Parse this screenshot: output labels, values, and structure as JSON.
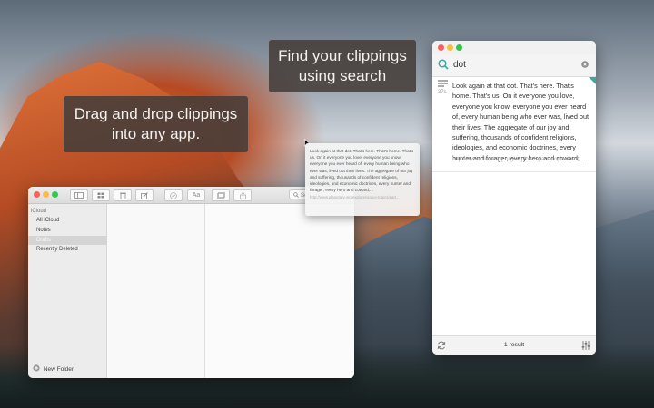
{
  "callouts": {
    "drag": "Drag and drop clippings\ninto any app.",
    "search": "Find your clippings\nusing search"
  },
  "notes_window": {
    "search_placeholder": "Search",
    "format_button": "Aa",
    "sidebar": {
      "section": "iCloud",
      "items": [
        "All iCloud",
        "Notes",
        "Drafts",
        "Recently Deleted"
      ]
    },
    "new_folder_label": "New Folder"
  },
  "drag_preview": {
    "text": "Look again at that dot. That's here. That's home. That's us. On it everyone you love, everyone you know, everyone you ever heard of, every human being who ever was, lived out their lives. The aggregate of our joy and suffering, thousands of confident religions, ideologies, and economic doctrines, every hunter and forager, every hero and coward,...",
    "url": "http://www.planetary.org/explore/space-topics/eart..."
  },
  "clippings_window": {
    "search_value": "dot",
    "clipping": {
      "age": "37s",
      "text": "Look again at that dot. That's here. That's home. That's us. On it everyone you love, everyone you know, everyone you ever heard of, every human being who ever was, lived out their lives. The aggregate of our joy and suffering, thousands of confident religions, ideologies, and economic doctrines, every hunter and forager, every hero and coward,...",
      "url": "http://www.planetary.org/explore/space-topics/eart..."
    },
    "result_count": "1 result"
  },
  "colors": {
    "traffic_red": "#fc605b",
    "traffic_yellow": "#fdbc40",
    "traffic_green": "#34c84a",
    "search_accent": "#3aa9a0",
    "sidebar_selected": "#d4d4d4"
  },
  "icons": [
    "close-icon",
    "minimize-icon",
    "zoom-icon",
    "sidebar-toggle-icon",
    "attachments-icon",
    "trash-icon",
    "compose-icon",
    "checklist-icon",
    "format-icon",
    "gallery-icon",
    "share-icon",
    "search-icon",
    "plus-circle-icon",
    "list-icon",
    "clear-search-icon",
    "sync-icon",
    "settings-sliders-icon",
    "mouse-cursor-icon"
  ]
}
